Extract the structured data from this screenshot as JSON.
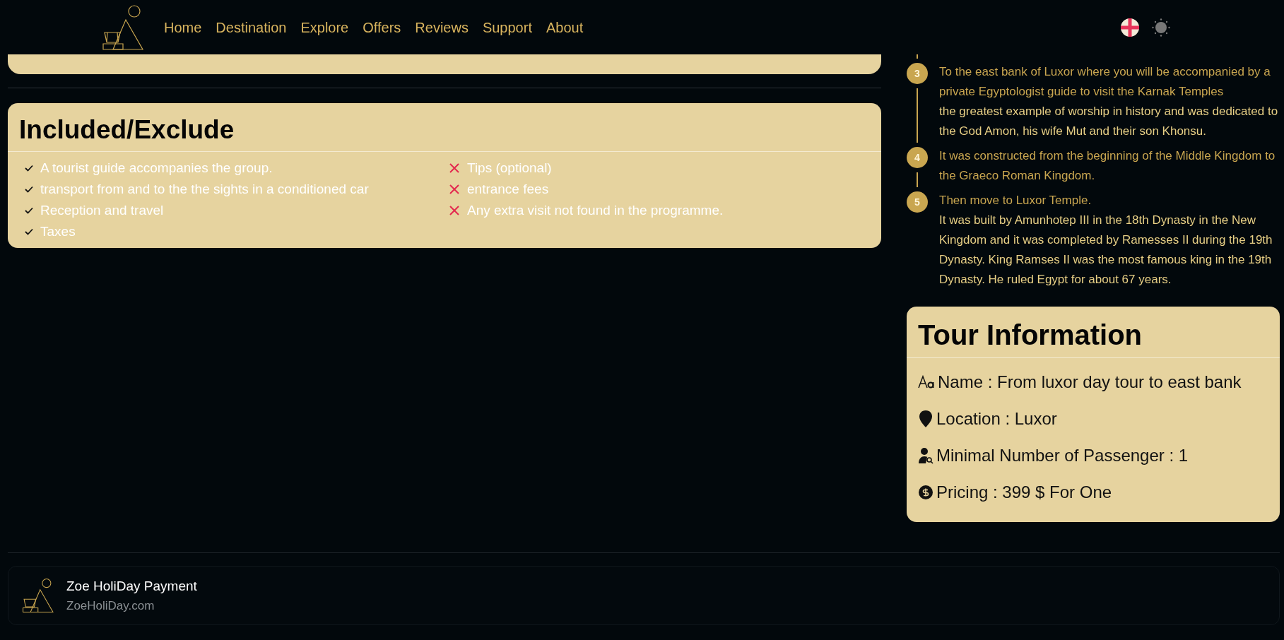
{
  "nav": {
    "links": [
      "Home",
      "Destination",
      "Explore",
      "Offers",
      "Reviews",
      "Support",
      "About"
    ]
  },
  "included": {
    "title": "Included/Exclude",
    "items": [
      {
        "kind": "included",
        "text": "A tourist guide accompanies the group."
      },
      {
        "kind": "included",
        "text": "transport from and to the the sights in a conditioned car"
      },
      {
        "kind": "included",
        "text": "Reception and travel"
      },
      {
        "kind": "included",
        "text": "Taxes"
      },
      {
        "kind": "excluded",
        "text": "Tips (optional)"
      },
      {
        "kind": "excluded",
        "text": "entrance fees"
      },
      {
        "kind": "excluded",
        "text": "Any extra visit not found in the programme."
      }
    ]
  },
  "timeline": [
    {
      "number": "3",
      "title": "To the east bank of Luxor where you will be accompanied by a private Egyptologist guide to visit the Karnak Temples",
      "detail": "the greatest example of worship in history and was dedicated to the God Amon, his wife Mut and their son Khonsu."
    },
    {
      "number": "4",
      "title": "It was constructed from the beginning of the Middle Kingdom to the Graeco Roman Kingdom."
    },
    {
      "number": "5",
      "title": "Then move to Luxor Temple.",
      "detail": "It was built by Amunhotep III in the 18th Dynasty in the New Kingdom and it was completed by Ramesses II during the 19th Dynasty. King Ramses II was the most famous king in the 19th Dynasty. He ruled Egypt for about 67 years."
    }
  ],
  "tour_info": {
    "title": "Tour Information",
    "rows": [
      {
        "kind": "name",
        "text": "Name : From luxor day tour to east bank"
      },
      {
        "kind": "location",
        "text": "Location : Luxor"
      },
      {
        "kind": "passengers",
        "text": "Minimal Number of Passenger : 1"
      },
      {
        "kind": "pricing",
        "text": "Pricing :  399 $ For One"
      }
    ]
  },
  "footer": {
    "title": "Zoe HoliDay Payment",
    "site": "ZoeHoliDay.com"
  }
}
